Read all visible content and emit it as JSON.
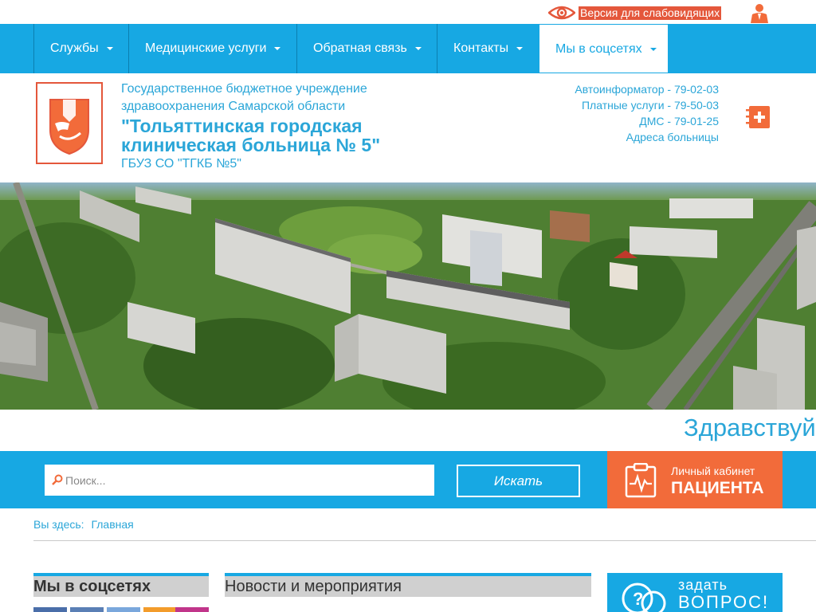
{
  "top_bar": {
    "low_vision_label": "Версия для слабовидящих",
    "eye_icon": "eye-icon",
    "user_icon": "user-suit-icon"
  },
  "nav": {
    "items": [
      {
        "label": "Службы",
        "has_dropdown": true
      },
      {
        "label": "Медицинские услуги",
        "has_dropdown": true
      },
      {
        "label": "Обратная связь",
        "has_dropdown": true
      },
      {
        "label": "Контакты",
        "has_dropdown": true
      },
      {
        "label": "Мы в соцсетях",
        "has_dropdown": true,
        "active": true
      }
    ]
  },
  "header": {
    "org_line1": "Государственное бюджетное учреждение",
    "org_line2": "здравоохранения Самарской области",
    "title_line1": "\"Тольяттинская городская",
    "title_line2": "клиническая больница  № 5\"",
    "short_name": "ГБУЗ СО \"ТГКБ №5\"",
    "contacts": [
      "Автоинформатор - 79-02-03",
      "Платные услуги - 79-50-03",
      "ДМС - 79-01-25",
      "Адреса больницы"
    ],
    "book_icon": "medical-book-icon"
  },
  "greeting": "Здравствуйт",
  "search": {
    "placeholder": "Поиск...",
    "value": "",
    "button_label": "Искать"
  },
  "patient_cabinet": {
    "small_label": "Личный кабинет",
    "big_label": "ПАЦИЕНТА"
  },
  "breadcrumb": {
    "prefix": "Вы здесь:",
    "home": "Главная"
  },
  "widgets": {
    "social_title": "Мы в соцсетях",
    "news_title": "Новости и мероприятия",
    "ask_line1": "задать",
    "ask_line2": "ВОПРОС!"
  },
  "colors": {
    "brand_blue": "#17a8e3",
    "accent_orange": "#f26b3a",
    "text_blue": "#2ba6d8",
    "logo_red": "#e4573b"
  }
}
